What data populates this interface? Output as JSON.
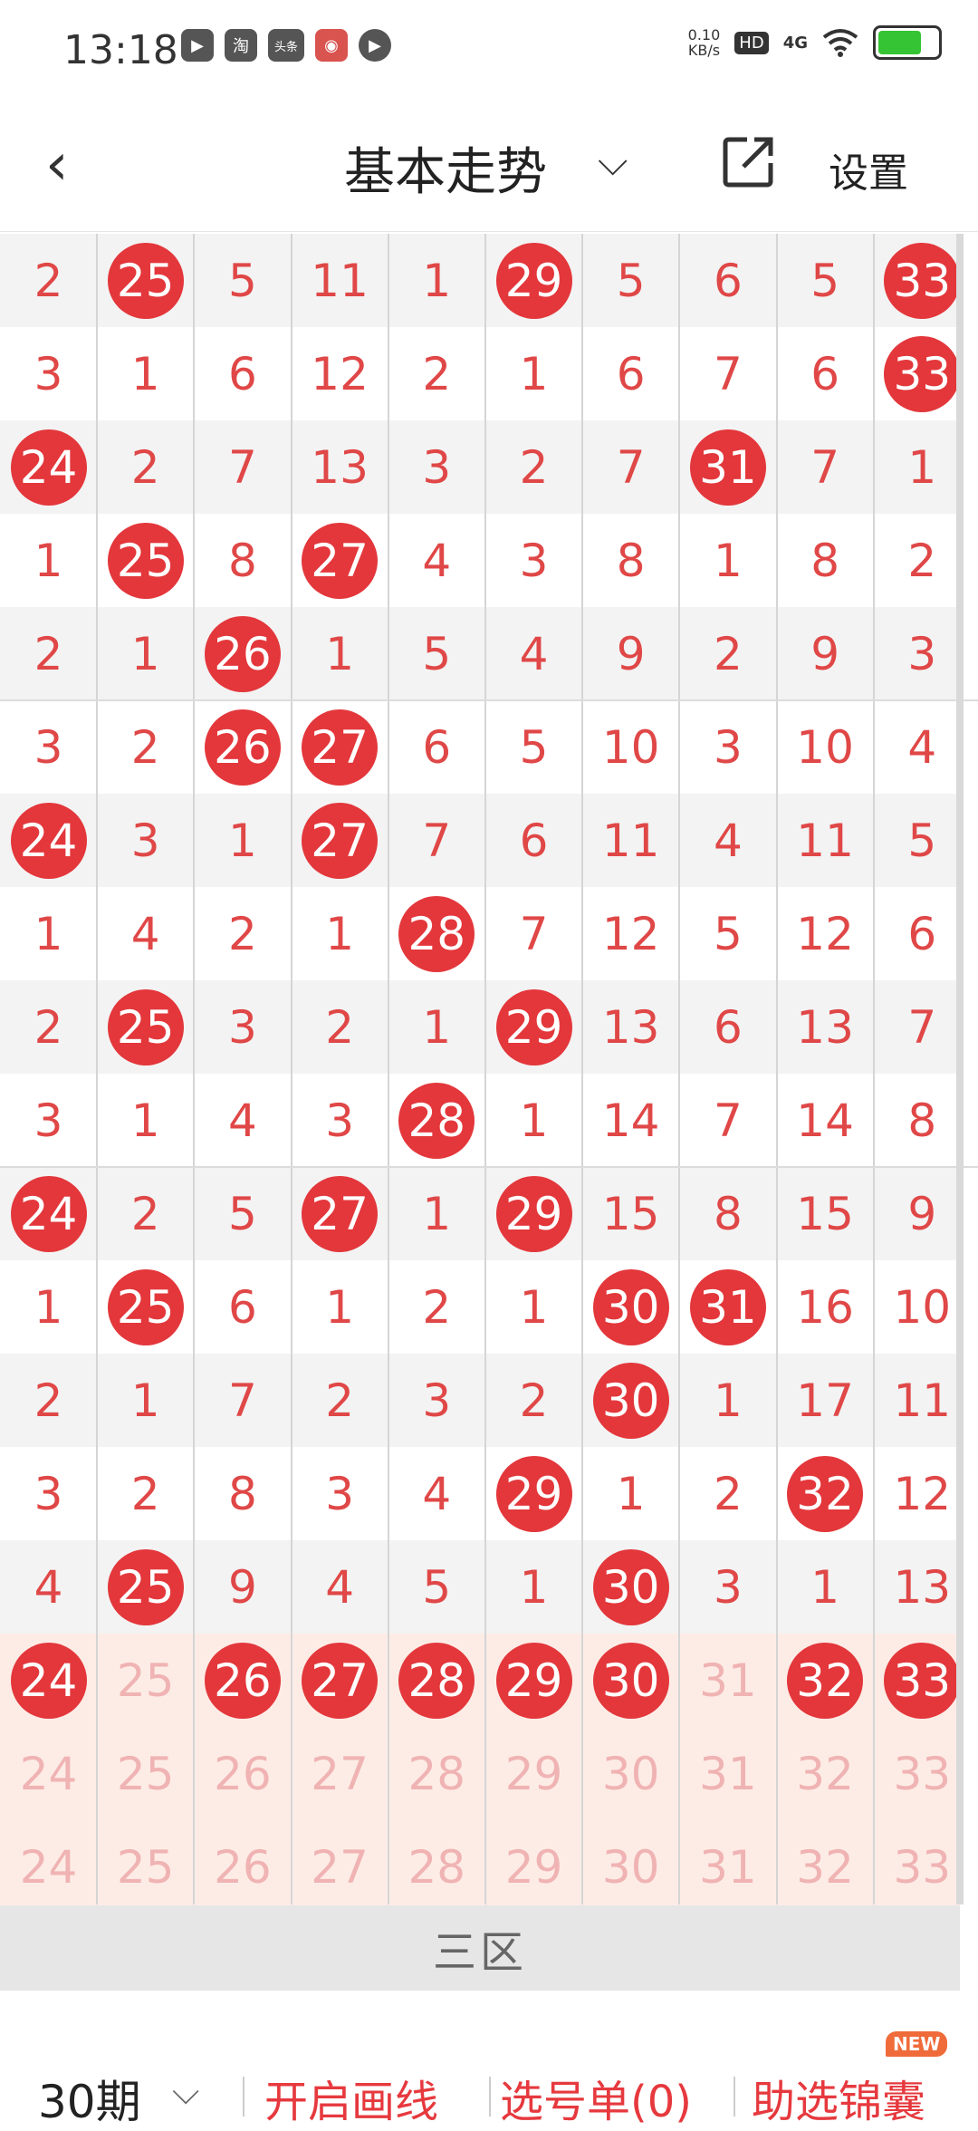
{
  "status_bar": {
    "time": "13:18",
    "app_icons": [
      "▶",
      "淘",
      "头条",
      "◉",
      "▶"
    ],
    "net_speed_value": "0.10",
    "net_speed_unit": "KB/s",
    "hd": "HD",
    "signal": "4G",
    "battery_level": 0.75
  },
  "header": {
    "back_icon": "‹",
    "title": "基本走势",
    "caret": "⌵",
    "settings_label": "设置"
  },
  "grid": {
    "rows": [
      [
        {
          "v": "2"
        },
        {
          "v": "25",
          "b": 1
        },
        {
          "v": "5"
        },
        {
          "v": "11"
        },
        {
          "v": "1"
        },
        {
          "v": "29",
          "b": 1
        },
        {
          "v": "5"
        },
        {
          "v": "6"
        },
        {
          "v": "5"
        },
        {
          "v": "33",
          "b": 1
        }
      ],
      [
        {
          "v": "3"
        },
        {
          "v": "1"
        },
        {
          "v": "6"
        },
        {
          "v": "12"
        },
        {
          "v": "2"
        },
        {
          "v": "1"
        },
        {
          "v": "6"
        },
        {
          "v": "7"
        },
        {
          "v": "6"
        },
        {
          "v": "33",
          "b": 1
        }
      ],
      [
        {
          "v": "24",
          "b": 1
        },
        {
          "v": "2"
        },
        {
          "v": "7"
        },
        {
          "v": "13"
        },
        {
          "v": "3"
        },
        {
          "v": "2"
        },
        {
          "v": "7"
        },
        {
          "v": "31",
          "b": 1
        },
        {
          "v": "7"
        },
        {
          "v": "1"
        }
      ],
      [
        {
          "v": "1"
        },
        {
          "v": "25",
          "b": 1
        },
        {
          "v": "8"
        },
        {
          "v": "27",
          "b": 1
        },
        {
          "v": "4"
        },
        {
          "v": "3"
        },
        {
          "v": "8"
        },
        {
          "v": "1"
        },
        {
          "v": "8"
        },
        {
          "v": "2"
        }
      ],
      [
        {
          "v": "2"
        },
        {
          "v": "1"
        },
        {
          "v": "26",
          "b": 1
        },
        {
          "v": "1"
        },
        {
          "v": "5"
        },
        {
          "v": "4"
        },
        {
          "v": "9"
        },
        {
          "v": "2"
        },
        {
          "v": "9"
        },
        {
          "v": "3"
        }
      ],
      [
        {
          "v": "3"
        },
        {
          "v": "2"
        },
        {
          "v": "26",
          "b": 1
        },
        {
          "v": "27",
          "b": 1
        },
        {
          "v": "6"
        },
        {
          "v": "5"
        },
        {
          "v": "10"
        },
        {
          "v": "3"
        },
        {
          "v": "10"
        },
        {
          "v": "4"
        }
      ],
      [
        {
          "v": "24",
          "b": 1
        },
        {
          "v": "3"
        },
        {
          "v": "1"
        },
        {
          "v": "27",
          "b": 1
        },
        {
          "v": "7"
        },
        {
          "v": "6"
        },
        {
          "v": "11"
        },
        {
          "v": "4"
        },
        {
          "v": "11"
        },
        {
          "v": "5"
        }
      ],
      [
        {
          "v": "1"
        },
        {
          "v": "4"
        },
        {
          "v": "2"
        },
        {
          "v": "1"
        },
        {
          "v": "28",
          "b": 1
        },
        {
          "v": "7"
        },
        {
          "v": "12"
        },
        {
          "v": "5"
        },
        {
          "v": "12"
        },
        {
          "v": "6"
        }
      ],
      [
        {
          "v": "2"
        },
        {
          "v": "25",
          "b": 1
        },
        {
          "v": "3"
        },
        {
          "v": "2"
        },
        {
          "v": "1"
        },
        {
          "v": "29",
          "b": 1
        },
        {
          "v": "13"
        },
        {
          "v": "6"
        },
        {
          "v": "13"
        },
        {
          "v": "7"
        }
      ],
      [
        {
          "v": "3"
        },
        {
          "v": "1"
        },
        {
          "v": "4"
        },
        {
          "v": "3"
        },
        {
          "v": "28",
          "b": 1
        },
        {
          "v": "1"
        },
        {
          "v": "14"
        },
        {
          "v": "7"
        },
        {
          "v": "14"
        },
        {
          "v": "8"
        }
      ],
      [
        {
          "v": "24",
          "b": 1
        },
        {
          "v": "2"
        },
        {
          "v": "5"
        },
        {
          "v": "27",
          "b": 1
        },
        {
          "v": "1"
        },
        {
          "v": "29",
          "b": 1
        },
        {
          "v": "15"
        },
        {
          "v": "8"
        },
        {
          "v": "15"
        },
        {
          "v": "9"
        }
      ],
      [
        {
          "v": "1"
        },
        {
          "v": "25",
          "b": 1
        },
        {
          "v": "6"
        },
        {
          "v": "1"
        },
        {
          "v": "2"
        },
        {
          "v": "1"
        },
        {
          "v": "30",
          "b": 1
        },
        {
          "v": "31",
          "b": 1
        },
        {
          "v": "16"
        },
        {
          "v": "10"
        }
      ],
      [
        {
          "v": "2"
        },
        {
          "v": "1"
        },
        {
          "v": "7"
        },
        {
          "v": "2"
        },
        {
          "v": "3"
        },
        {
          "v": "2"
        },
        {
          "v": "30",
          "b": 1
        },
        {
          "v": "1"
        },
        {
          "v": "17"
        },
        {
          "v": "11"
        }
      ],
      [
        {
          "v": "3"
        },
        {
          "v": "2"
        },
        {
          "v": "8"
        },
        {
          "v": "3"
        },
        {
          "v": "4"
        },
        {
          "v": "29",
          "b": 1
        },
        {
          "v": "1"
        },
        {
          "v": "2"
        },
        {
          "v": "32",
          "b": 1
        },
        {
          "v": "12"
        }
      ],
      [
        {
          "v": "4"
        },
        {
          "v": "25",
          "b": 1
        },
        {
          "v": "9"
        },
        {
          "v": "4"
        },
        {
          "v": "5"
        },
        {
          "v": "1"
        },
        {
          "v": "30",
          "b": 1
        },
        {
          "v": "3"
        },
        {
          "v": "1"
        },
        {
          "v": "13"
        }
      ],
      [
        {
          "v": "24",
          "b": 1
        },
        {
          "v": "25",
          "l": 1
        },
        {
          "v": "26",
          "b": 1
        },
        {
          "v": "27",
          "b": 1
        },
        {
          "v": "28",
          "b": 1
        },
        {
          "v": "29",
          "b": 1
        },
        {
          "v": "30",
          "b": 1
        },
        {
          "v": "31",
          "l": 1
        },
        {
          "v": "32",
          "b": 1
        },
        {
          "v": "33",
          "b": 1
        }
      ],
      [
        {
          "v": "24",
          "l": 1
        },
        {
          "v": "25",
          "l": 1
        },
        {
          "v": "26",
          "l": 1
        },
        {
          "v": "27",
          "l": 1
        },
        {
          "v": "28",
          "l": 1
        },
        {
          "v": "29",
          "l": 1
        },
        {
          "v": "30",
          "l": 1
        },
        {
          "v": "31",
          "l": 1
        },
        {
          "v": "32",
          "l": 1
        },
        {
          "v": "33",
          "l": 1
        }
      ],
      [
        {
          "v": "24",
          "l": 1
        },
        {
          "v": "25",
          "l": 1
        },
        {
          "v": "26",
          "l": 1
        },
        {
          "v": "27",
          "l": 1
        },
        {
          "v": "28",
          "l": 1
        },
        {
          "v": "29",
          "l": 1
        },
        {
          "v": "30",
          "l": 1
        },
        {
          "v": "31",
          "l": 1
        },
        {
          "v": "32",
          "l": 1
        },
        {
          "v": "33",
          "l": 1
        }
      ]
    ]
  },
  "zone_label": "三区",
  "bottom_bar": {
    "period": "30期",
    "period_caret": "⌵",
    "draw_lines": "开启画线",
    "pick_list": "选号单(0)",
    "assist": "助选锦囊",
    "new_badge": "NEW"
  }
}
